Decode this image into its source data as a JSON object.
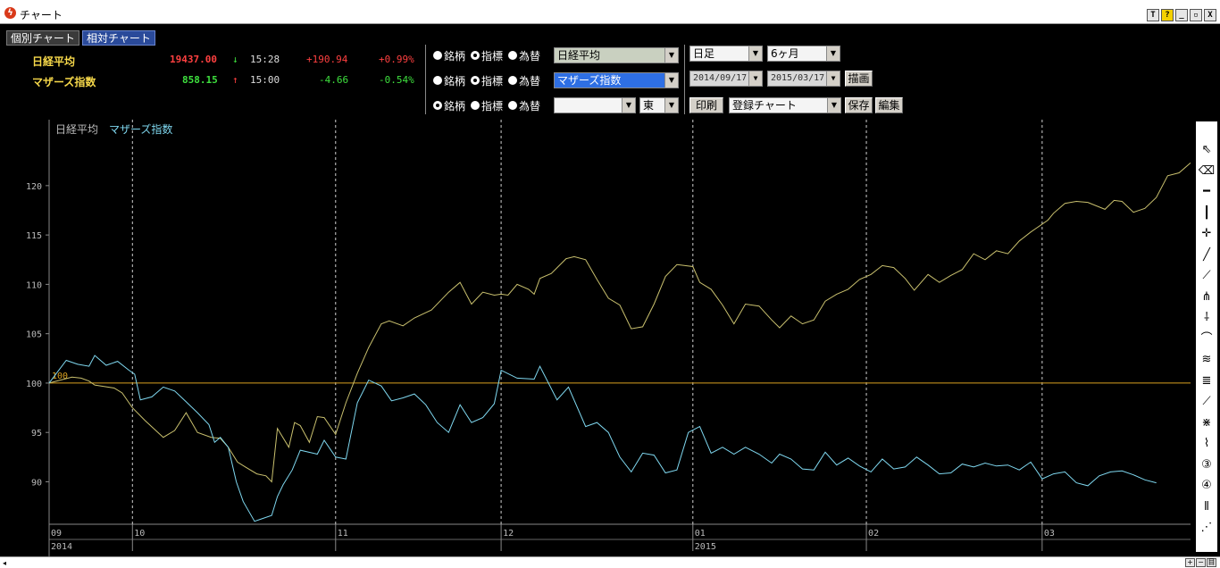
{
  "window": {
    "title": "チャート",
    "buttons": [
      "T",
      "?",
      "_",
      "▫",
      "X"
    ]
  },
  "tabs": [
    {
      "label": "個別チャート"
    },
    {
      "label": "相対チャート"
    }
  ],
  "quotes": [
    {
      "name": "日経平均",
      "price": "19437.00",
      "arrow": "↓",
      "time": "15:28",
      "change": "+190.94",
      "pct": "+0.99%"
    },
    {
      "name": "マザーズ指数",
      "price": "858.15",
      "arrow": "↑",
      "time": "15:00",
      "change": "-4.66",
      "pct": "-0.54%"
    }
  ],
  "rows": [
    {
      "options": [
        "銘柄",
        "指標",
        "為替"
      ],
      "selected": 1,
      "value": "日経平均"
    },
    {
      "options": [
        "銘柄",
        "指標",
        "為替"
      ],
      "selected": 1,
      "value": "マザーズ指数"
    },
    {
      "options": [
        "銘柄",
        "指標",
        "為替"
      ],
      "selected": 0,
      "value": "",
      "exchange": "東"
    }
  ],
  "controls": {
    "period": "日足",
    "range": "6ヶ月",
    "date_from": "2014/09/17",
    "date_to": "2015/03/17",
    "draw": "描画",
    "print": "印刷",
    "saved_chart": "登録チャート",
    "save": "保存",
    "edit": "編集"
  },
  "colors": {
    "nikkei": "#c9c06e",
    "mothers": "#7fd8f0",
    "baseline": "#d9a020",
    "grid": "#cfcfcf"
  },
  "chart_data": {
    "type": "line",
    "legend": [
      "日経平均",
      "マザーズ指数"
    ],
    "baseline": {
      "value": 100,
      "label": "100"
    },
    "ylim": [
      85.7,
      126.5
    ],
    "yticks": [
      90,
      95,
      100,
      105,
      110,
      115,
      120
    ],
    "xlim": [
      0,
      100
    ],
    "xticks": [
      {
        "x": 0,
        "label": "09",
        "year": "2014"
      },
      {
        "x": 7.3,
        "label": "10"
      },
      {
        "x": 25.1,
        "label": "11"
      },
      {
        "x": 39.6,
        "label": "12"
      },
      {
        "x": 56.4,
        "label": "01",
        "year": "2015"
      },
      {
        "x": 71.6,
        "label": "02"
      },
      {
        "x": 87.0,
        "label": "03"
      }
    ],
    "series": [
      {
        "name": "日経平均",
        "color": "#c9c06e",
        "points": [
          [
            0,
            100
          ],
          [
            2,
            100.6
          ],
          [
            2.8,
            100.5
          ],
          [
            3.5,
            100.2
          ],
          [
            4,
            99.8
          ],
          [
            5.7,
            99.5
          ],
          [
            6.4,
            99
          ],
          [
            7.3,
            97.5
          ],
          [
            8.4,
            96.2
          ],
          [
            10,
            94.5
          ],
          [
            11,
            95.2
          ],
          [
            12,
            97
          ],
          [
            13,
            95
          ],
          [
            14.2,
            94.5
          ],
          [
            15,
            94.4
          ],
          [
            15.7,
            93.5
          ],
          [
            16.5,
            92
          ],
          [
            17.2,
            91.5
          ],
          [
            18.2,
            90.8
          ],
          [
            19,
            90.6
          ],
          [
            19.5,
            90
          ],
          [
            20,
            95.4
          ],
          [
            21,
            93.5
          ],
          [
            21.5,
            96
          ],
          [
            22,
            95.7
          ],
          [
            22.8,
            94
          ],
          [
            23.5,
            96.6
          ],
          [
            24.1,
            96.5
          ],
          [
            25.1,
            94.8
          ],
          [
            26,
            98
          ],
          [
            27,
            101
          ],
          [
            28,
            103.6
          ],
          [
            29.1,
            106
          ],
          [
            29.8,
            106.3
          ],
          [
            31,
            105.8
          ],
          [
            32,
            106.6
          ],
          [
            33.5,
            107.4
          ],
          [
            35,
            109.2
          ],
          [
            36,
            110.2
          ],
          [
            37,
            108
          ],
          [
            38,
            109.2
          ],
          [
            39,
            108.9
          ],
          [
            39.6,
            109
          ],
          [
            40.2,
            108.9
          ],
          [
            41,
            110
          ],
          [
            42,
            109.5
          ],
          [
            42.5,
            109
          ],
          [
            43,
            110.6
          ],
          [
            44,
            111.1
          ],
          [
            45.3,
            112.6
          ],
          [
            46,
            112.8
          ],
          [
            47,
            112.5
          ],
          [
            48,
            110.5
          ],
          [
            49,
            108.6
          ],
          [
            50,
            107.9
          ],
          [
            51,
            105.5
          ],
          [
            52,
            105.7
          ],
          [
            53,
            108
          ],
          [
            54,
            110.8
          ],
          [
            55,
            112
          ],
          [
            56.4,
            111.8
          ],
          [
            57,
            110.2
          ],
          [
            58,
            109.5
          ],
          [
            59,
            107.9
          ],
          [
            60,
            106
          ],
          [
            61,
            108
          ],
          [
            62.2,
            107.8
          ],
          [
            63.3,
            106.4
          ],
          [
            64,
            105.6
          ],
          [
            65,
            106.8
          ],
          [
            66,
            106
          ],
          [
            67,
            106.4
          ],
          [
            68,
            108.3
          ],
          [
            69,
            109
          ],
          [
            70,
            109.5
          ],
          [
            71,
            110.5
          ],
          [
            72,
            111
          ],
          [
            73,
            111.9
          ],
          [
            74,
            111.7
          ],
          [
            75,
            110.6
          ],
          [
            75.8,
            109.4
          ],
          [
            77,
            111
          ],
          [
            78,
            110.2
          ],
          [
            79,
            110.9
          ],
          [
            80,
            111.5
          ],
          [
            81,
            113.1
          ],
          [
            82,
            112.5
          ],
          [
            83,
            113.4
          ],
          [
            84,
            113.1
          ],
          [
            85,
            114.4
          ],
          [
            86,
            115.3
          ],
          [
            86.5,
            115.7
          ],
          [
            87.5,
            116.5
          ],
          [
            88,
            117.2
          ],
          [
            89,
            118.2
          ],
          [
            90,
            118.4
          ],
          [
            91,
            118.3
          ],
          [
            92.5,
            117.6
          ],
          [
            93.3,
            118.5
          ],
          [
            94,
            118.4
          ],
          [
            95,
            117.3
          ],
          [
            96,
            117.7
          ],
          [
            97,
            118.8
          ],
          [
            98,
            121
          ],
          [
            99,
            121.3
          ],
          [
            100,
            122.3
          ]
        ]
      },
      {
        "name": "マザーズ指数",
        "color": "#7fd8f0",
        "points": [
          [
            0,
            100
          ],
          [
            1.5,
            102.3
          ],
          [
            2.5,
            101.9
          ],
          [
            3.5,
            101.7
          ],
          [
            4,
            102.8
          ],
          [
            5,
            101.8
          ],
          [
            6,
            102.2
          ],
          [
            7,
            101.3
          ],
          [
            7.5,
            100.9
          ],
          [
            8,
            98.3
          ],
          [
            9,
            98.6
          ],
          [
            10,
            99.6
          ],
          [
            11,
            99.2
          ],
          [
            12,
            98.1
          ],
          [
            13,
            97
          ],
          [
            14,
            95.8
          ],
          [
            14.5,
            94
          ],
          [
            15,
            94.5
          ],
          [
            15.7,
            93.5
          ],
          [
            16.4,
            90
          ],
          [
            17,
            88
          ],
          [
            18,
            86
          ],
          [
            18.5,
            86.2
          ],
          [
            19.5,
            86.6
          ],
          [
            20,
            88.5
          ],
          [
            20.5,
            89.7
          ],
          [
            21.3,
            91.2
          ],
          [
            22,
            93.2
          ],
          [
            23.5,
            92.8
          ],
          [
            24.1,
            94.2
          ],
          [
            25.1,
            92.5
          ],
          [
            26,
            92.3
          ],
          [
            27,
            98
          ],
          [
            28,
            100.3
          ],
          [
            29.1,
            99.7
          ],
          [
            30,
            98.2
          ],
          [
            31,
            98.5
          ],
          [
            32,
            98.9
          ],
          [
            33,
            97.8
          ],
          [
            34,
            96
          ],
          [
            35,
            95
          ],
          [
            36,
            97.8
          ],
          [
            37,
            96
          ],
          [
            38,
            96.5
          ],
          [
            39,
            97.9
          ],
          [
            39.6,
            101.3
          ],
          [
            41,
            100.5
          ],
          [
            42.5,
            100.4
          ],
          [
            43,
            101.7
          ],
          [
            44.5,
            98.3
          ],
          [
            45.5,
            99.6
          ],
          [
            47,
            95.6
          ],
          [
            48,
            96
          ],
          [
            49,
            95
          ],
          [
            50,
            92.5
          ],
          [
            51,
            91
          ],
          [
            52,
            92.9
          ],
          [
            53,
            92.7
          ],
          [
            54,
            90.9
          ],
          [
            55,
            91.2
          ],
          [
            56,
            95
          ],
          [
            57,
            95.6
          ],
          [
            58,
            92.9
          ],
          [
            59,
            93.5
          ],
          [
            60,
            92.8
          ],
          [
            61,
            93.5
          ],
          [
            62.2,
            92.8
          ],
          [
            63.3,
            91.9
          ],
          [
            64,
            92.8
          ],
          [
            65,
            92.3
          ],
          [
            66,
            91.3
          ],
          [
            67,
            91.2
          ],
          [
            68,
            93
          ],
          [
            69,
            91.7
          ],
          [
            70,
            92.4
          ],
          [
            71,
            91.6
          ],
          [
            72,
            91
          ],
          [
            73,
            92.3
          ],
          [
            74,
            91.3
          ],
          [
            75,
            91.5
          ],
          [
            76,
            92.5
          ],
          [
            77,
            91.7
          ],
          [
            78,
            90.8
          ],
          [
            79,
            90.9
          ],
          [
            80,
            91.8
          ],
          [
            81,
            91.5
          ],
          [
            82,
            91.9
          ],
          [
            83,
            91.6
          ],
          [
            84,
            91.7
          ],
          [
            85,
            91.2
          ],
          [
            86,
            92
          ],
          [
            87,
            90.3
          ],
          [
            88,
            90.8
          ],
          [
            89,
            91
          ],
          [
            90,
            89.9
          ],
          [
            91,
            89.6
          ],
          [
            92,
            90.6
          ],
          [
            93,
            91
          ],
          [
            94,
            91.1
          ],
          [
            95,
            90.7
          ],
          [
            96,
            90.2
          ],
          [
            97,
            89.9
          ]
        ]
      }
    ]
  },
  "tools": [
    "cursor-icon",
    "eraser-icon",
    "horizontal-line-icon",
    "vertical-line-icon",
    "crosshair-icon",
    "trend-line-icon",
    "fan-icon",
    "pitchfork-icon",
    "fib-fan-icon",
    "fib-arc-icon",
    "channel-icon",
    "fib-retracement-icon",
    "regression-icon",
    "gann-icon",
    "wave-icon",
    "cycle-3-icon",
    "cycle-4-icon",
    "period-lines-icon",
    "zigzag-icon"
  ],
  "zoom": [
    "+",
    "−",
    "目"
  ]
}
